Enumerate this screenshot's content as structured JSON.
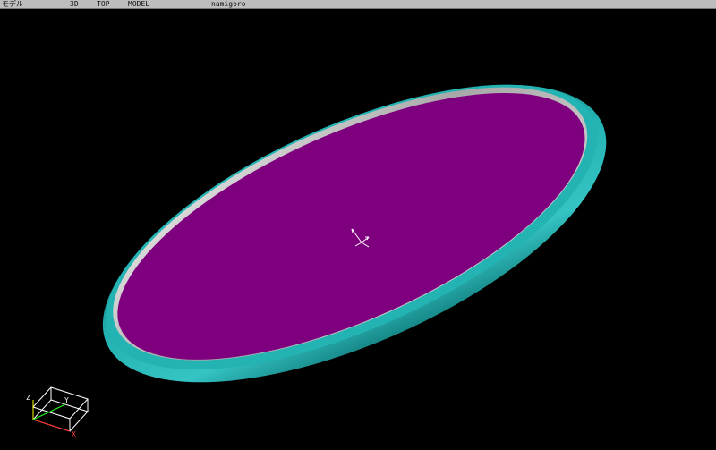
{
  "header": {
    "mode": "モデル",
    "view": "3D",
    "direction": "TOP",
    "kind": "MODEL",
    "name": "namigoro"
  },
  "axes": {
    "x": "X",
    "y": "Y",
    "z": "Z"
  },
  "colors": {
    "background": "#000000",
    "disc_face": "#7e007e",
    "rim": "#25b7b7",
    "rim_highlight": "#d9dcdc"
  },
  "icons": {
    "center": "origin-axes-icon",
    "corner": "view-cube-icon"
  }
}
